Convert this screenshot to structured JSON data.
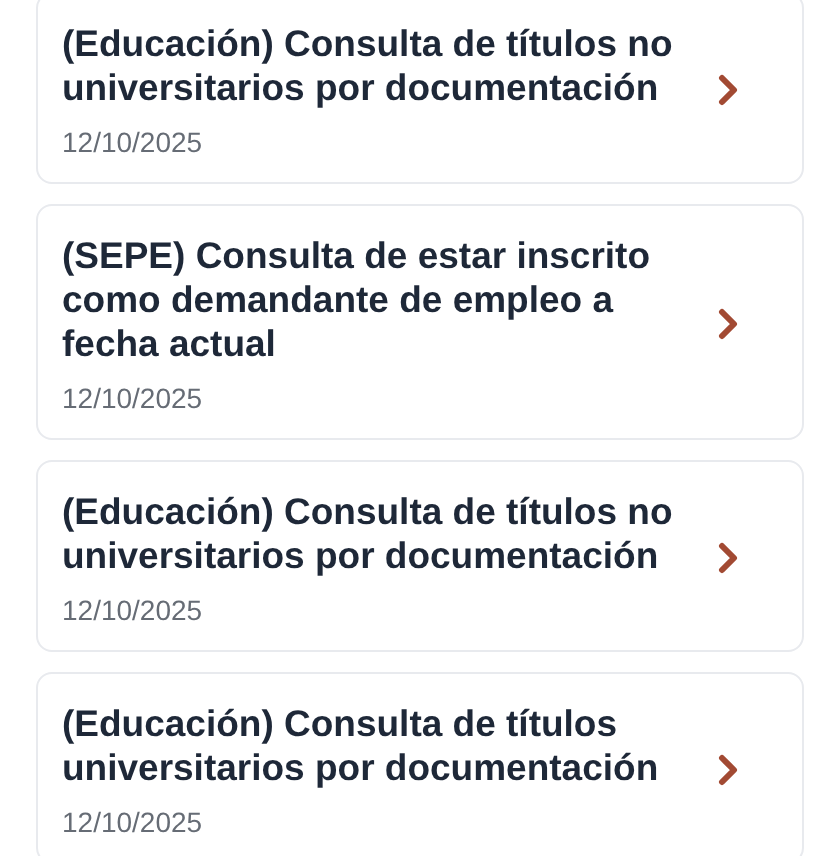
{
  "items": [
    {
      "title": "(Educación) Consulta de títulos no universitarios por documentación",
      "date": "12/10/2025"
    },
    {
      "title": "(SEPE) Consulta de estar inscrito como demandante de empleo a fecha actual",
      "date": "12/10/2025"
    },
    {
      "title": "(Educación) Consulta de títulos no universitarios por documentación",
      "date": "12/10/2025"
    },
    {
      "title": "(Educación) Consulta de títulos universitarios por documentación",
      "date": "12/10/2025"
    }
  ]
}
